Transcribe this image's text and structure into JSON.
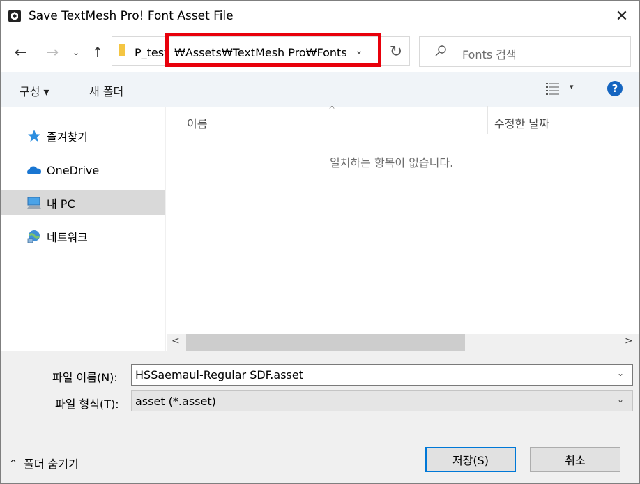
{
  "window": {
    "title": "Save TextMesh Pro! Font Asset File",
    "close_glyph": "✕"
  },
  "nav": {
    "back_glyph": "←",
    "forward_glyph": "→",
    "recent_glyph": "⌄",
    "up_glyph": "↑",
    "address_prefix": "P_test",
    "address_path": "₩Assets₩TextMesh Pro₩Fonts",
    "dropdown_glyph": "⌄",
    "refresh_glyph": "↻",
    "search_placeholder": "Fonts 검색",
    "highlight_color": "#e8000b"
  },
  "toolbar": {
    "organize_label": "구성 ▾",
    "new_folder_label": "새 폴더",
    "view_dropdown_glyph": "▾",
    "help_label": "?"
  },
  "sidebar": {
    "items": [
      {
        "label": "즐겨찾기",
        "icon": "star-icon"
      },
      {
        "label": "OneDrive",
        "icon": "cloud-icon"
      },
      {
        "label": "내 PC",
        "icon": "computer-icon",
        "selected": true
      },
      {
        "label": "네트워크",
        "icon": "network-icon"
      }
    ]
  },
  "file_list": {
    "columns": [
      "이름",
      "수정한 날짜"
    ],
    "sort_glyph": "^",
    "empty_message": "일치하는 항목이 없습니다."
  },
  "scroll": {
    "left_glyph": "<",
    "right_glyph": ">"
  },
  "form": {
    "filename_label": "파일 이름(N):",
    "filename_value": "HSSaemaul-Regular SDF.asset",
    "filetype_label": "파일 형식(T):",
    "filetype_value": "asset (*.asset)",
    "dropdown_glyph": "⌄"
  },
  "footer": {
    "hide_folders_label": "폴더 숨기기",
    "hide_arrow_glyph": "^",
    "save_label": "저장(S)",
    "cancel_label": "취소"
  },
  "colors": {
    "accent": "#0078d7",
    "help": "#1565c0",
    "selected_nav": "#d9d9d9"
  }
}
